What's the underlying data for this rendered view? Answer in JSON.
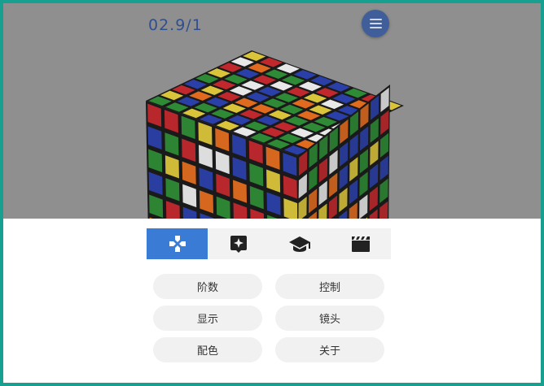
{
  "header": {
    "counter": "02.9/1",
    "menu_icon": "hamburger-menu-icon"
  },
  "colors": {
    "scene_bg": "#8f8f8f",
    "accent": "#3a7bd5",
    "cube_colors": [
      "#c0282d",
      "#2b3fa8",
      "#2e8a35",
      "#d9c43a",
      "#e06b1f",
      "#e8e8e8"
    ]
  },
  "tabs": [
    {
      "icon": "gamepad-icon",
      "active": true
    },
    {
      "icon": "sparkle-icon",
      "active": false
    },
    {
      "icon": "graduation-cap-icon",
      "active": false
    },
    {
      "icon": "clapperboard-icon",
      "active": false
    }
  ],
  "buttons": {
    "order": "阶数",
    "control": "控制",
    "display": "显示",
    "camera": "镜头",
    "color_scheme": "配色",
    "about": "关于"
  }
}
